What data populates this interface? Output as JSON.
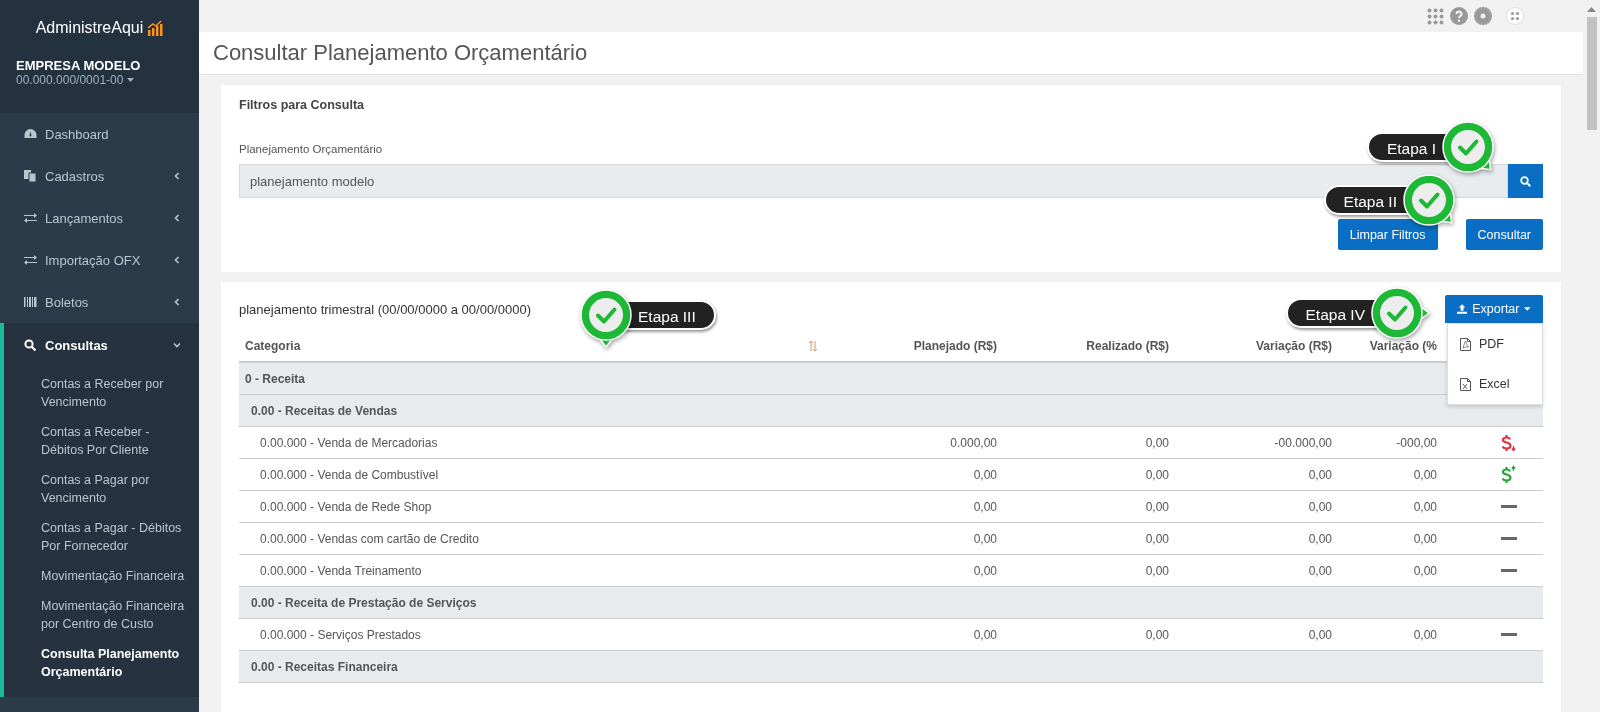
{
  "sidebar": {
    "logo": "AdministreAqui",
    "company": "EMPRESA MODELO",
    "cnpj": "00.000.000/0001-00",
    "items": [
      {
        "label": "Dashboard",
        "kind": "link",
        "selected": false
      },
      {
        "label": "Cadastros",
        "kind": "menu",
        "expanded": false,
        "selected": false
      },
      {
        "label": "Lançamentos",
        "kind": "menu",
        "expanded": false,
        "selected": false
      },
      {
        "label": "Importação OFX",
        "kind": "menu",
        "expanded": false,
        "selected": false
      },
      {
        "label": "Boletos",
        "kind": "menu",
        "expanded": false,
        "selected": false
      },
      {
        "label": "Consultas",
        "kind": "menu",
        "expanded": true,
        "selected": true,
        "children": [
          {
            "label": "Contas a Receber por Vencimento",
            "selected": false
          },
          {
            "label": "Contas a Receber - Débitos Por Cliente",
            "selected": false
          },
          {
            "label": "Contas a Pagar por Vencimento",
            "selected": false
          },
          {
            "label": "Contas a Pagar - Débitos Por Fornecedor",
            "selected": false
          },
          {
            "label": "Movimentação Financeira",
            "selected": false
          },
          {
            "label": "Movimentação Financeira por Centro de Custo",
            "selected": false
          },
          {
            "label": "Consulta Planejamento Orçamentário",
            "selected": true
          }
        ]
      }
    ]
  },
  "page_title": "Consultar Planejamento Orçamentário",
  "filters": {
    "title": "Filtros para Consulta",
    "field_label": "Planejamento Orçamentário",
    "field_value": "planejamento modelo",
    "buttons": [
      "Limpar Filtros",
      "Consultar"
    ]
  },
  "results": {
    "title": "planejamento trimestral (00/00/0000 a 00/00/0000)",
    "export": {
      "label": "Exportar",
      "expanded": true,
      "options": [
        "PDF",
        "Excel"
      ]
    },
    "columns": [
      "Categoria",
      "Planejado (R$)",
      "Realizado (R$)",
      "Variação (R$)",
      "Variação (%"
    ],
    "rows": [
      {
        "kind": "group",
        "label": "0 - Receita",
        "children": [
          {
            "kind": "group",
            "label": "0.00 - Receitas de Vendas",
            "children": [
              {
                "kind": "item",
                "label": "0.00.000 - Venda de Mercadorias",
                "planejado": "0.000,00",
                "realizado": "0,00",
                "variacao": "-00.000,00",
                "variacao_pct": "-000,00",
                "indicator": {
                  "kind": "down"
                }
              },
              {
                "kind": "item",
                "label": "0.00.000 - Venda de Combustível",
                "planejado": "0,00",
                "realizado": "0,00",
                "variacao": "0,00",
                "variacao_pct": "0,00",
                "indicator": {
                  "kind": "up"
                }
              },
              {
                "kind": "item",
                "label": "0.00.000 - Venda de Rede Shop",
                "planejado": "0,00",
                "realizado": "0,00",
                "variacao": "0,00",
                "variacao_pct": "0,00",
                "indicator": {
                  "kind": "flat"
                }
              },
              {
                "kind": "item",
                "label": "0.00.000 - Vendas com cartão de Credito",
                "planejado": "0,00",
                "realizado": "0,00",
                "variacao": "0,00",
                "variacao_pct": "0,00",
                "indicator": {
                  "kind": "flat"
                }
              },
              {
                "kind": "item",
                "label": "0.00.000 - Venda Treinamento",
                "planejado": "0,00",
                "realizado": "0,00",
                "variacao": "0,00",
                "variacao_pct": "0,00",
                "indicator": {
                  "kind": "flat"
                }
              }
            ]
          },
          {
            "kind": "group",
            "label": "0.00 - Receita de Prestação de Serviços",
            "children": [
              {
                "kind": "item",
                "label": "0.00.000 - Serviços Prestados",
                "planejado": "0,00",
                "realizado": "0,00",
                "variacao": "0,00",
                "variacao_pct": "0,00",
                "indicator": {
                  "kind": "flat"
                }
              }
            ]
          },
          {
            "kind": "group",
            "label": "0.00 - Receitas Financeira"
          }
        ]
      }
    ]
  },
  "callouts": [
    {
      "label": "Etapa I",
      "kind": "diagonal"
    },
    {
      "label": "Etapa II",
      "kind": "diagonal"
    },
    {
      "label": "Etapa III",
      "kind": "down"
    },
    {
      "label": "Etapa IV",
      "kind": "right"
    }
  ]
}
